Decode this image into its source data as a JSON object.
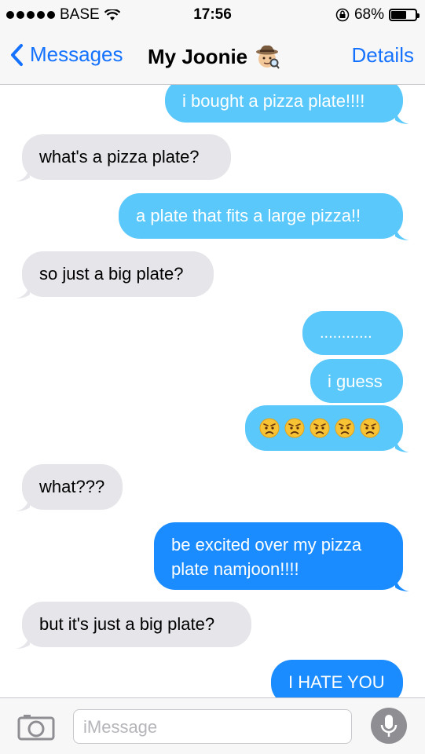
{
  "status_bar": {
    "carrier": "BASE",
    "time": "17:56",
    "battery": "68%",
    "battery_level": 0.68,
    "signal_dots": 5,
    "wifi_icon": "wifi-icon",
    "lock_icon": "orientation-lock-icon"
  },
  "nav": {
    "back_label": "Messages",
    "title": "My Joonie",
    "title_emoji": "detective-emoji",
    "details_label": "Details"
  },
  "messages": [
    {
      "from": "me",
      "text": "i bought a pizza plate!!!!"
    },
    {
      "from": "them",
      "text": "what's a pizza plate?"
    },
    {
      "from": "me",
      "text": "a plate that fits a large pizza!!"
    },
    {
      "from": "them",
      "text": "so just a big plate?"
    },
    {
      "from": "me",
      "text": "............"
    },
    {
      "from": "me",
      "text": "i guess"
    },
    {
      "from": "me",
      "emoji": "angry-face-emoji",
      "emoji_count": 5
    },
    {
      "from": "them",
      "text": "what???"
    },
    {
      "from": "me",
      "text": "be excited over my pizza plate namjoon!!!!"
    },
    {
      "from": "them",
      "text": "but it's just a big plate?"
    },
    {
      "from": "me",
      "text": "I HATE YOU"
    }
  ],
  "input": {
    "placeholder": "iMessage",
    "camera_icon": "camera-icon",
    "mic_icon": "microphone-icon"
  },
  "colors": {
    "accent": "#1572ff",
    "outgoing_light": "#5ac8fa",
    "outgoing_dark": "#1a8cff",
    "incoming": "#e5e5ea",
    "bar_bg": "#f7f7f7"
  }
}
